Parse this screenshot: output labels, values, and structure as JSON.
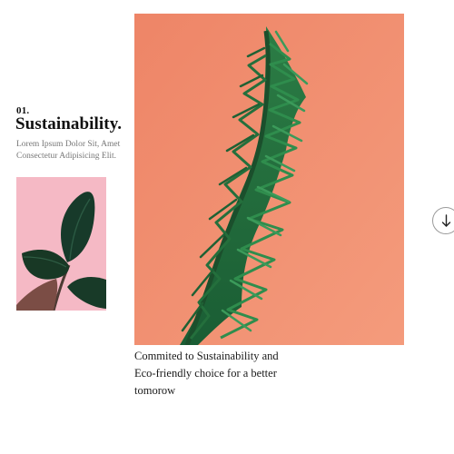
{
  "section": {
    "number": "01.",
    "title": "Sustainability.",
    "subtitle": "Lorem Ipsum Dolor Sit, Amet Consectetur Adipisicing Elit."
  },
  "images": {
    "thumbnail_icon": "rubber-plant-photo",
    "hero_icon": "norfolk-pine-photo",
    "thumbnail_background": "#f4b6c2",
    "hero_background": "#f38a6c"
  },
  "caption": "Commited to Sustainability and Eco-friendly choice for a better tomorow",
  "scroll_button": {
    "icon": "arrow-down-icon"
  }
}
